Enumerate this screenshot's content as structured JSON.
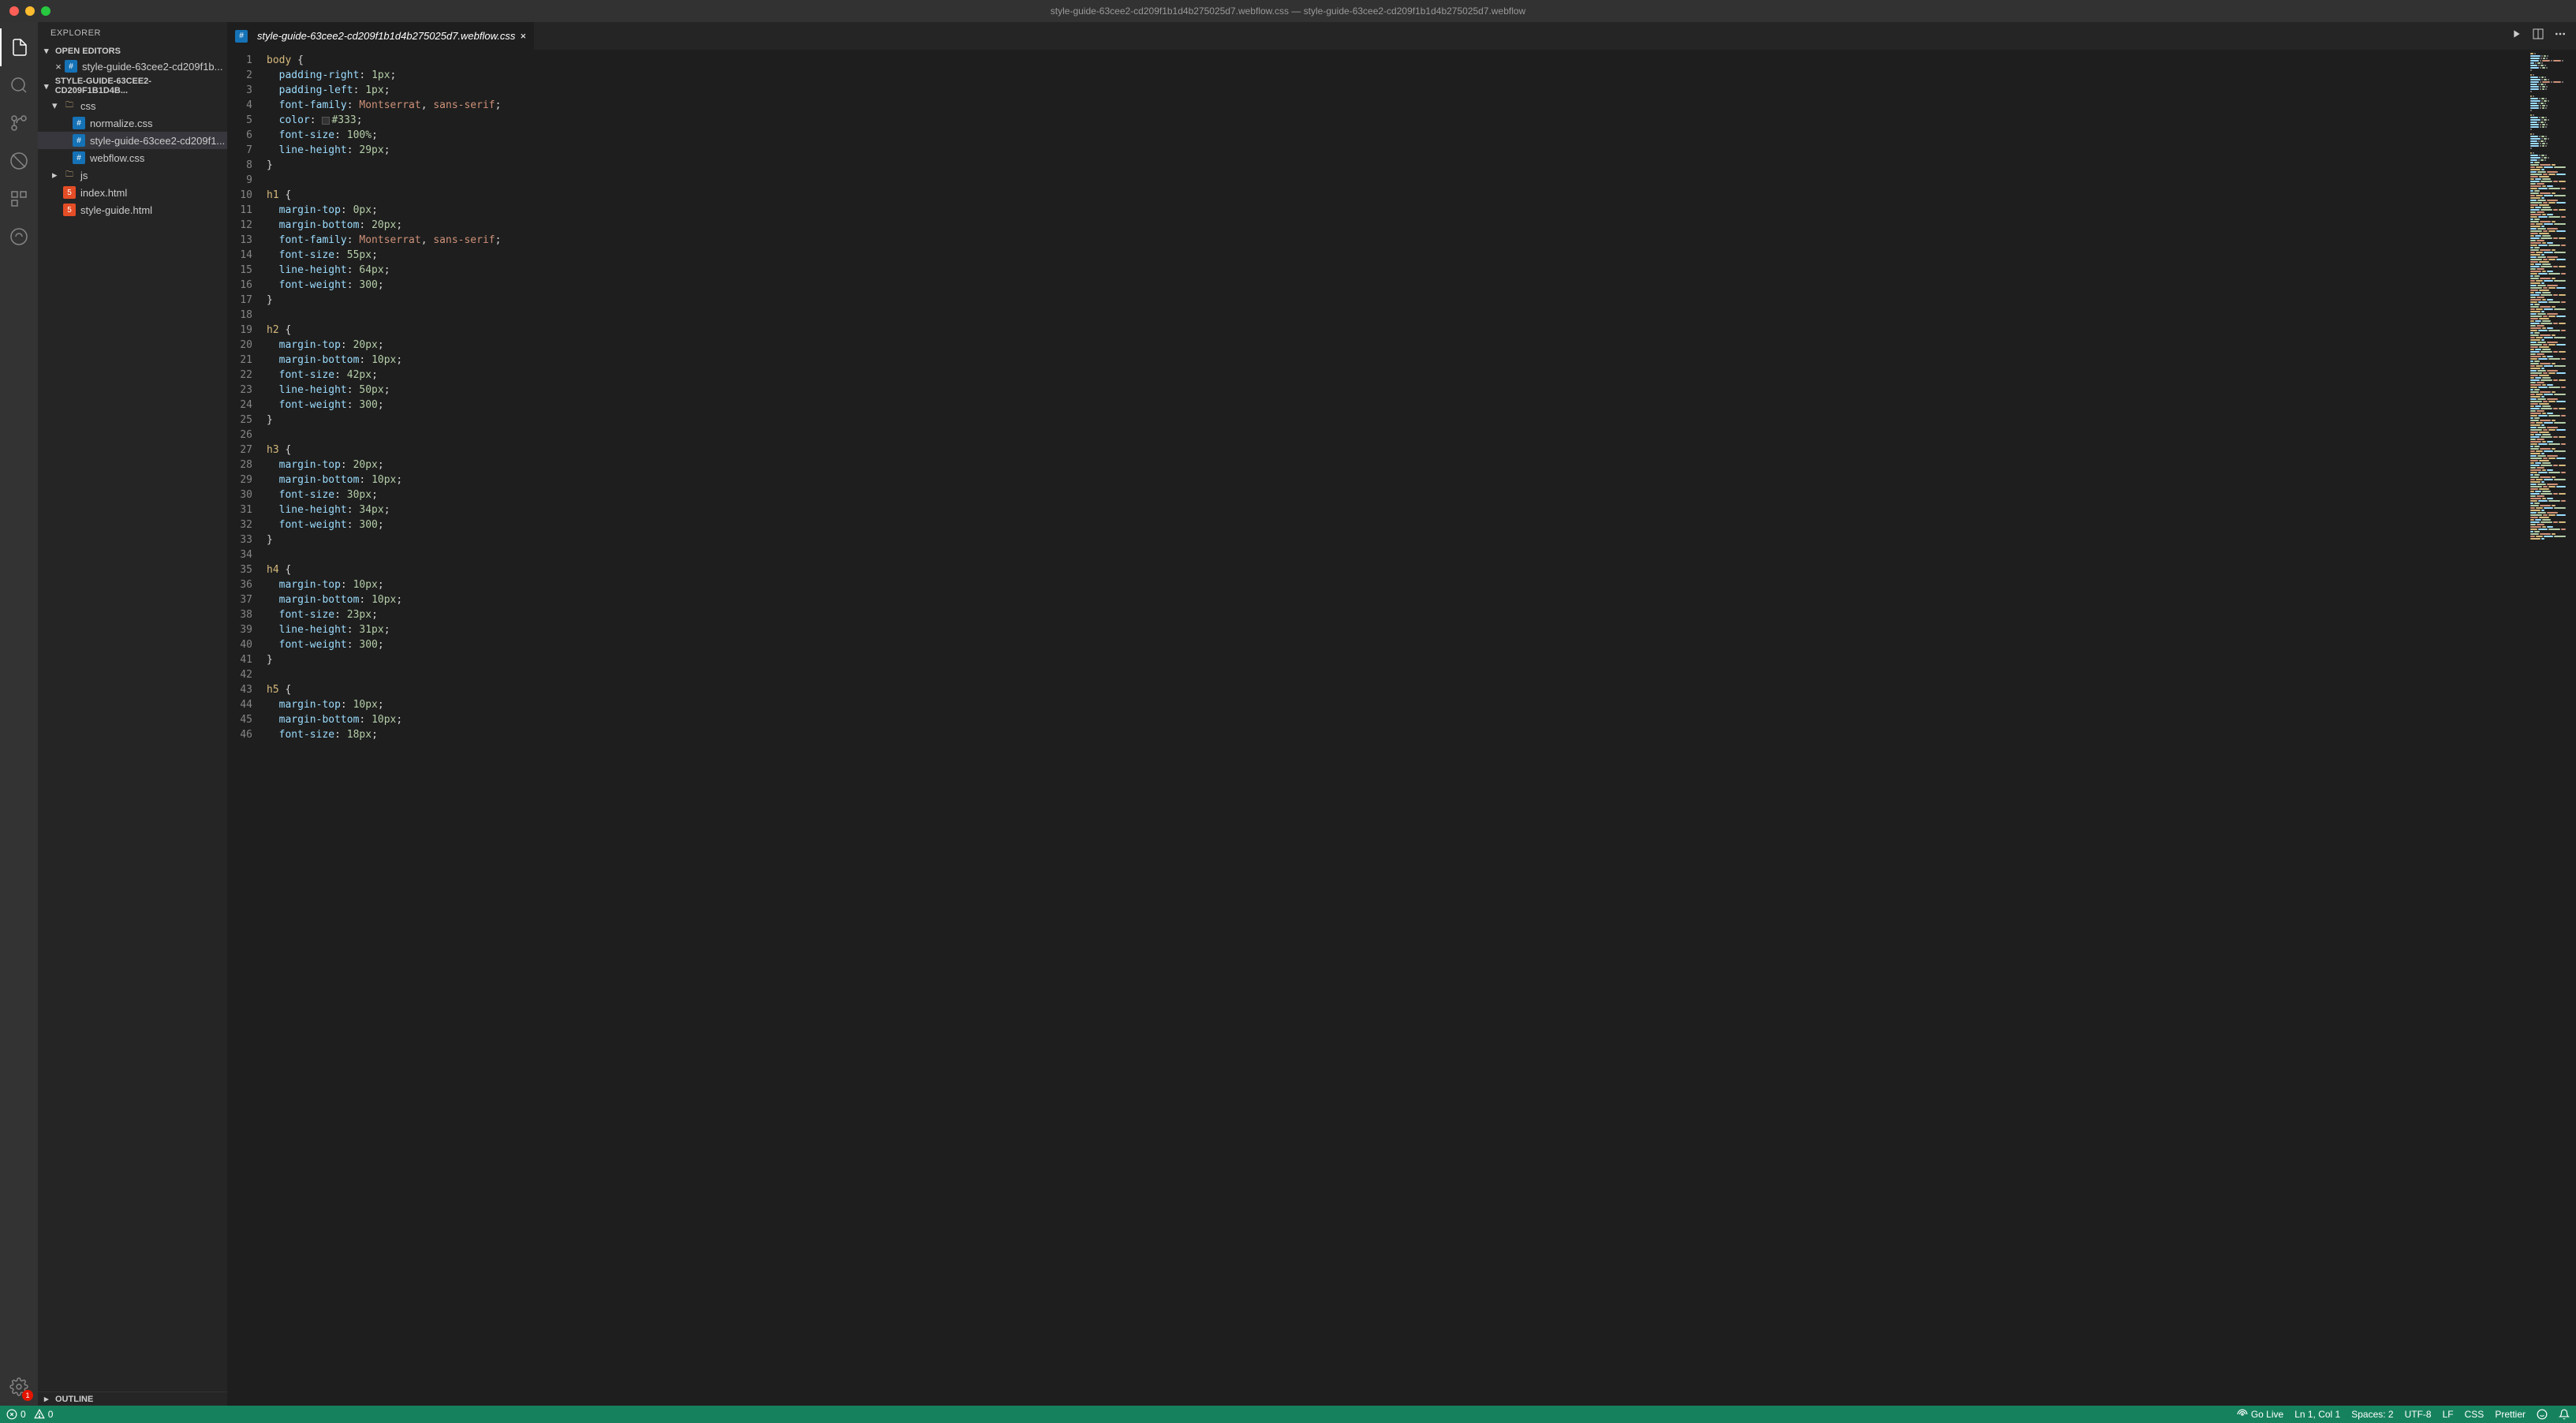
{
  "titlebar": {
    "title": "style-guide-63cee2-cd209f1b1d4b275025d7.webflow.css — style-guide-63cee2-cd209f1b1d4b275025d7.webflow"
  },
  "sidebar": {
    "title": "EXPLORER",
    "open_editors_label": "OPEN EDITORS",
    "open_editors": [
      {
        "name": "style-guide-63cee2-cd209f1b...",
        "icon": "css",
        "dirty": false
      }
    ],
    "folder_label": "STYLE-GUIDE-63CEE2-CD209F1B1D4B...",
    "tree": [
      {
        "name": "css",
        "type": "folder",
        "depth": 1,
        "expanded": true
      },
      {
        "name": "normalize.css",
        "type": "file",
        "icon": "css",
        "depth": 2
      },
      {
        "name": "style-guide-63cee2-cd209f1...",
        "type": "file",
        "icon": "css",
        "depth": 2,
        "active": true
      },
      {
        "name": "webflow.css",
        "type": "file",
        "icon": "css",
        "depth": 2
      },
      {
        "name": "js",
        "type": "folder",
        "depth": 1,
        "expanded": false
      },
      {
        "name": "index.html",
        "type": "file",
        "icon": "html",
        "depth": 1
      },
      {
        "name": "style-guide.html",
        "type": "file",
        "icon": "html",
        "depth": 1
      }
    ],
    "outline_label": "OUTLINE"
  },
  "tabs": [
    {
      "name": "style-guide-63cee2-cd209f1b1d4b275025d7.webflow.css",
      "icon": "css",
      "active": true
    }
  ],
  "editor": {
    "lines": [
      [
        [
          "sel",
          "body"
        ],
        [
          "punc",
          " {"
        ]
      ],
      [
        [
          "prop",
          "  padding-right"
        ],
        [
          "punc",
          ": "
        ],
        [
          "num",
          "1px"
        ],
        [
          "punc",
          ";"
        ]
      ],
      [
        [
          "prop",
          "  padding-left"
        ],
        [
          "punc",
          ": "
        ],
        [
          "num",
          "1px"
        ],
        [
          "punc",
          ";"
        ]
      ],
      [
        [
          "prop",
          "  font-family"
        ],
        [
          "punc",
          ": "
        ],
        [
          "str",
          "Montserrat"
        ],
        [
          "punc",
          ", "
        ],
        [
          "str",
          "sans-serif"
        ],
        [
          "punc",
          ";"
        ]
      ],
      [
        [
          "prop",
          "  color"
        ],
        [
          "punc",
          ": "
        ],
        [
          "swatch",
          ""
        ],
        [
          "num",
          "#333"
        ],
        [
          "punc",
          ";"
        ]
      ],
      [
        [
          "prop",
          "  font-size"
        ],
        [
          "punc",
          ": "
        ],
        [
          "num",
          "100%"
        ],
        [
          "punc",
          ";"
        ]
      ],
      [
        [
          "prop",
          "  line-height"
        ],
        [
          "punc",
          ": "
        ],
        [
          "num",
          "29px"
        ],
        [
          "punc",
          ";"
        ]
      ],
      [
        [
          "punc",
          "}"
        ]
      ],
      [],
      [
        [
          "sel",
          "h1"
        ],
        [
          "punc",
          " {"
        ]
      ],
      [
        [
          "prop",
          "  margin-top"
        ],
        [
          "punc",
          ": "
        ],
        [
          "num",
          "0px"
        ],
        [
          "punc",
          ";"
        ]
      ],
      [
        [
          "prop",
          "  margin-bottom"
        ],
        [
          "punc",
          ": "
        ],
        [
          "num",
          "20px"
        ],
        [
          "punc",
          ";"
        ]
      ],
      [
        [
          "prop",
          "  font-family"
        ],
        [
          "punc",
          ": "
        ],
        [
          "str",
          "Montserrat"
        ],
        [
          "punc",
          ", "
        ],
        [
          "str",
          "sans-serif"
        ],
        [
          "punc",
          ";"
        ]
      ],
      [
        [
          "prop",
          "  font-size"
        ],
        [
          "punc",
          ": "
        ],
        [
          "num",
          "55px"
        ],
        [
          "punc",
          ";"
        ]
      ],
      [
        [
          "prop",
          "  line-height"
        ],
        [
          "punc",
          ": "
        ],
        [
          "num",
          "64px"
        ],
        [
          "punc",
          ";"
        ]
      ],
      [
        [
          "prop",
          "  font-weight"
        ],
        [
          "punc",
          ": "
        ],
        [
          "num",
          "300"
        ],
        [
          "punc",
          ";"
        ]
      ],
      [
        [
          "punc",
          "}"
        ]
      ],
      [],
      [
        [
          "sel",
          "h2"
        ],
        [
          "punc",
          " {"
        ]
      ],
      [
        [
          "prop",
          "  margin-top"
        ],
        [
          "punc",
          ": "
        ],
        [
          "num",
          "20px"
        ],
        [
          "punc",
          ";"
        ]
      ],
      [
        [
          "prop",
          "  margin-bottom"
        ],
        [
          "punc",
          ": "
        ],
        [
          "num",
          "10px"
        ],
        [
          "punc",
          ";"
        ]
      ],
      [
        [
          "prop",
          "  font-size"
        ],
        [
          "punc",
          ": "
        ],
        [
          "num",
          "42px"
        ],
        [
          "punc",
          ";"
        ]
      ],
      [
        [
          "prop",
          "  line-height"
        ],
        [
          "punc",
          ": "
        ],
        [
          "num",
          "50px"
        ],
        [
          "punc",
          ";"
        ]
      ],
      [
        [
          "prop",
          "  font-weight"
        ],
        [
          "punc",
          ": "
        ],
        [
          "num",
          "300"
        ],
        [
          "punc",
          ";"
        ]
      ],
      [
        [
          "punc",
          "}"
        ]
      ],
      [],
      [
        [
          "sel",
          "h3"
        ],
        [
          "punc",
          " {"
        ]
      ],
      [
        [
          "prop",
          "  margin-top"
        ],
        [
          "punc",
          ": "
        ],
        [
          "num",
          "20px"
        ],
        [
          "punc",
          ";"
        ]
      ],
      [
        [
          "prop",
          "  margin-bottom"
        ],
        [
          "punc",
          ": "
        ],
        [
          "num",
          "10px"
        ],
        [
          "punc",
          ";"
        ]
      ],
      [
        [
          "prop",
          "  font-size"
        ],
        [
          "punc",
          ": "
        ],
        [
          "num",
          "30px"
        ],
        [
          "punc",
          ";"
        ]
      ],
      [
        [
          "prop",
          "  line-height"
        ],
        [
          "punc",
          ": "
        ],
        [
          "num",
          "34px"
        ],
        [
          "punc",
          ";"
        ]
      ],
      [
        [
          "prop",
          "  font-weight"
        ],
        [
          "punc",
          ": "
        ],
        [
          "num",
          "300"
        ],
        [
          "punc",
          ";"
        ]
      ],
      [
        [
          "punc",
          "}"
        ]
      ],
      [],
      [
        [
          "sel",
          "h4"
        ],
        [
          "punc",
          " {"
        ]
      ],
      [
        [
          "prop",
          "  margin-top"
        ],
        [
          "punc",
          ": "
        ],
        [
          "num",
          "10px"
        ],
        [
          "punc",
          ";"
        ]
      ],
      [
        [
          "prop",
          "  margin-bottom"
        ],
        [
          "punc",
          ": "
        ],
        [
          "num",
          "10px"
        ],
        [
          "punc",
          ";"
        ]
      ],
      [
        [
          "prop",
          "  font-size"
        ],
        [
          "punc",
          ": "
        ],
        [
          "num",
          "23px"
        ],
        [
          "punc",
          ";"
        ]
      ],
      [
        [
          "prop",
          "  line-height"
        ],
        [
          "punc",
          ": "
        ],
        [
          "num",
          "31px"
        ],
        [
          "punc",
          ";"
        ]
      ],
      [
        [
          "prop",
          "  font-weight"
        ],
        [
          "punc",
          ": "
        ],
        [
          "num",
          "300"
        ],
        [
          "punc",
          ";"
        ]
      ],
      [
        [
          "punc",
          "}"
        ]
      ],
      [],
      [
        [
          "sel",
          "h5"
        ],
        [
          "punc",
          " {"
        ]
      ],
      [
        [
          "prop",
          "  margin-top"
        ],
        [
          "punc",
          ": "
        ],
        [
          "num",
          "10px"
        ],
        [
          "punc",
          ";"
        ]
      ],
      [
        [
          "prop",
          "  margin-bottom"
        ],
        [
          "punc",
          ": "
        ],
        [
          "num",
          "10px"
        ],
        [
          "punc",
          ";"
        ]
      ],
      [
        [
          "prop",
          "  font-size"
        ],
        [
          "punc",
          ": "
        ],
        [
          "num",
          "18px"
        ],
        [
          "punc",
          ";"
        ]
      ]
    ]
  },
  "status": {
    "errors": "0",
    "warnings": "0",
    "go_live": "Go Live",
    "ln_col": "Ln 1, Col 1",
    "spaces": "Spaces: 2",
    "encoding": "UTF-8",
    "eol": "LF",
    "language": "CSS",
    "formatter": "Prettier"
  }
}
